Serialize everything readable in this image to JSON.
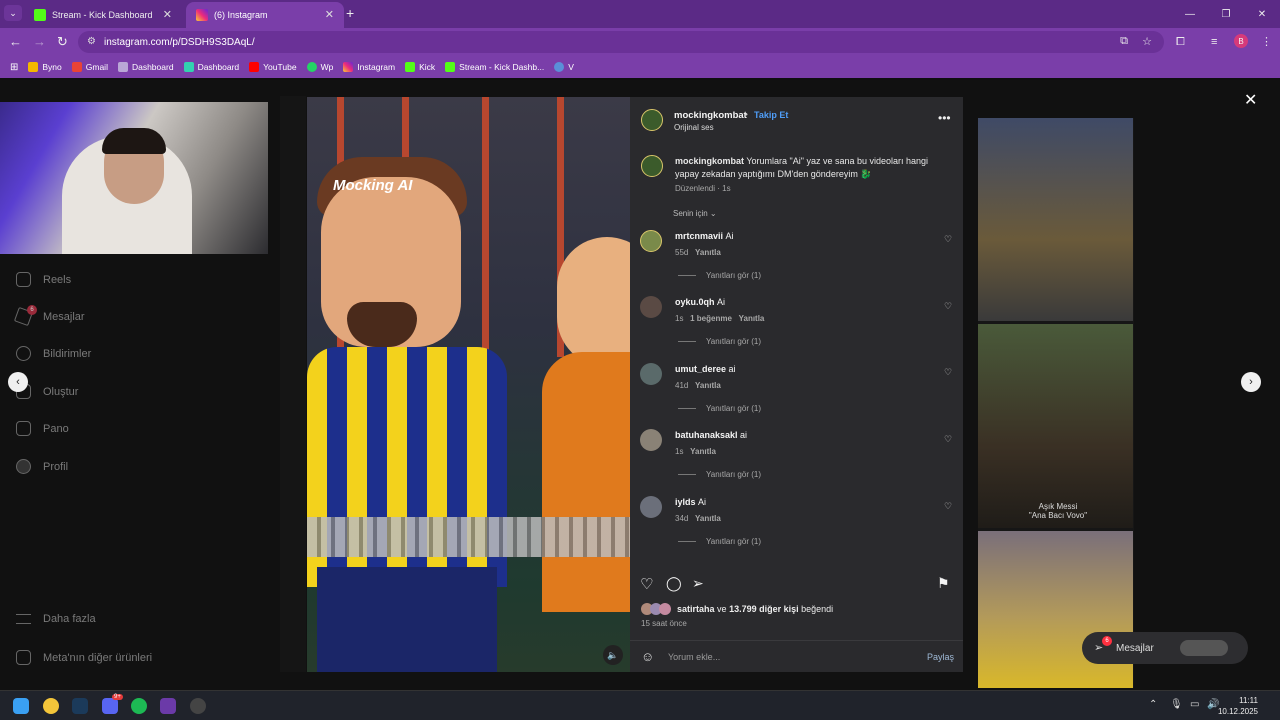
{
  "browser": {
    "tabs": [
      {
        "title": "Stream - Kick Dashboard",
        "active": false
      },
      {
        "title": "(6) Instagram",
        "active": true
      }
    ],
    "url": "instagram.com/p/DSDH9S3DAqL/",
    "bookmarks": [
      "Byno",
      "Gmail",
      "Dashboard",
      "Dashboard",
      "YouTube",
      "Wp",
      "Instagram",
      "Kick",
      "Stream - Kick Dashb...",
      "V"
    ],
    "profile_initial": "B"
  },
  "sidebar": {
    "items": [
      "Reels",
      "Mesajlar",
      "Bildirimler",
      "Oluştur",
      "Pano",
      "Profil"
    ],
    "messages_badge": "6",
    "bottom": [
      "Daha fazla",
      "Meta'nın diğer ürünleri"
    ]
  },
  "video": {
    "overlay_text": "Mocking AI"
  },
  "post": {
    "username": "mockingkombat",
    "follow_label": "Takip Et",
    "separator": "•",
    "audio": "Orijinal ses",
    "caption_user": "mockingkombat",
    "caption_text": "Yorumlara \"Ai\" yaz ve sana bu videoları hangi yapay zekadan yaptığımı DM'den göndereyim 🐉",
    "caption_meta": "Düzenlendi · 1s",
    "sort_label": "Senin için",
    "comments": [
      {
        "user": "mrtcnmavii",
        "text": "Ai",
        "meta": "55d",
        "reply": "Yanıtla",
        "likes": "",
        "view_replies": "Yanıtları gör (1)"
      },
      {
        "user": "oyku.0qh",
        "text": "Ai",
        "meta": "1s",
        "likes": "1 beğenme",
        "reply": "Yanıtla",
        "view_replies": "Yanıtları gör (1)"
      },
      {
        "user": "umut_deree",
        "text": "ai",
        "meta": "41d",
        "reply": "Yanıtla",
        "likes": "",
        "view_replies": "Yanıtları gör (1)"
      },
      {
        "user": "batuhanaksakl",
        "text": "ai",
        "meta": "1s",
        "reply": "Yanıtla",
        "likes": "",
        "view_replies": "Yanıtları gör (1)"
      },
      {
        "user": "iylds",
        "text": "Ai",
        "meta": "34d",
        "reply": "Yanıtla",
        "likes": "",
        "view_replies": "Yanıtları gör (1)"
      }
    ],
    "likes_user": "satirtaha",
    "likes_and": "ve",
    "likes_rest": "13.799 diğer kişi",
    "likes_suffix": "beğendi",
    "time_ago": "15 saat önce",
    "comment_placeholder": "Yorum ekle...",
    "share_label": "Paylaş"
  },
  "right_thumbs": {
    "caption": "Aşık Messi\n\"Ana Bacı Vovo\""
  },
  "messages_pill": {
    "label": "Mesajlar",
    "badge": "6"
  },
  "taskbar": {
    "time": "11:11",
    "date": "10.12.2025",
    "discord_badge": "9+"
  },
  "colors": {
    "accent_purple": "#7a3ea9",
    "instagram_blue": "#0095f6"
  }
}
